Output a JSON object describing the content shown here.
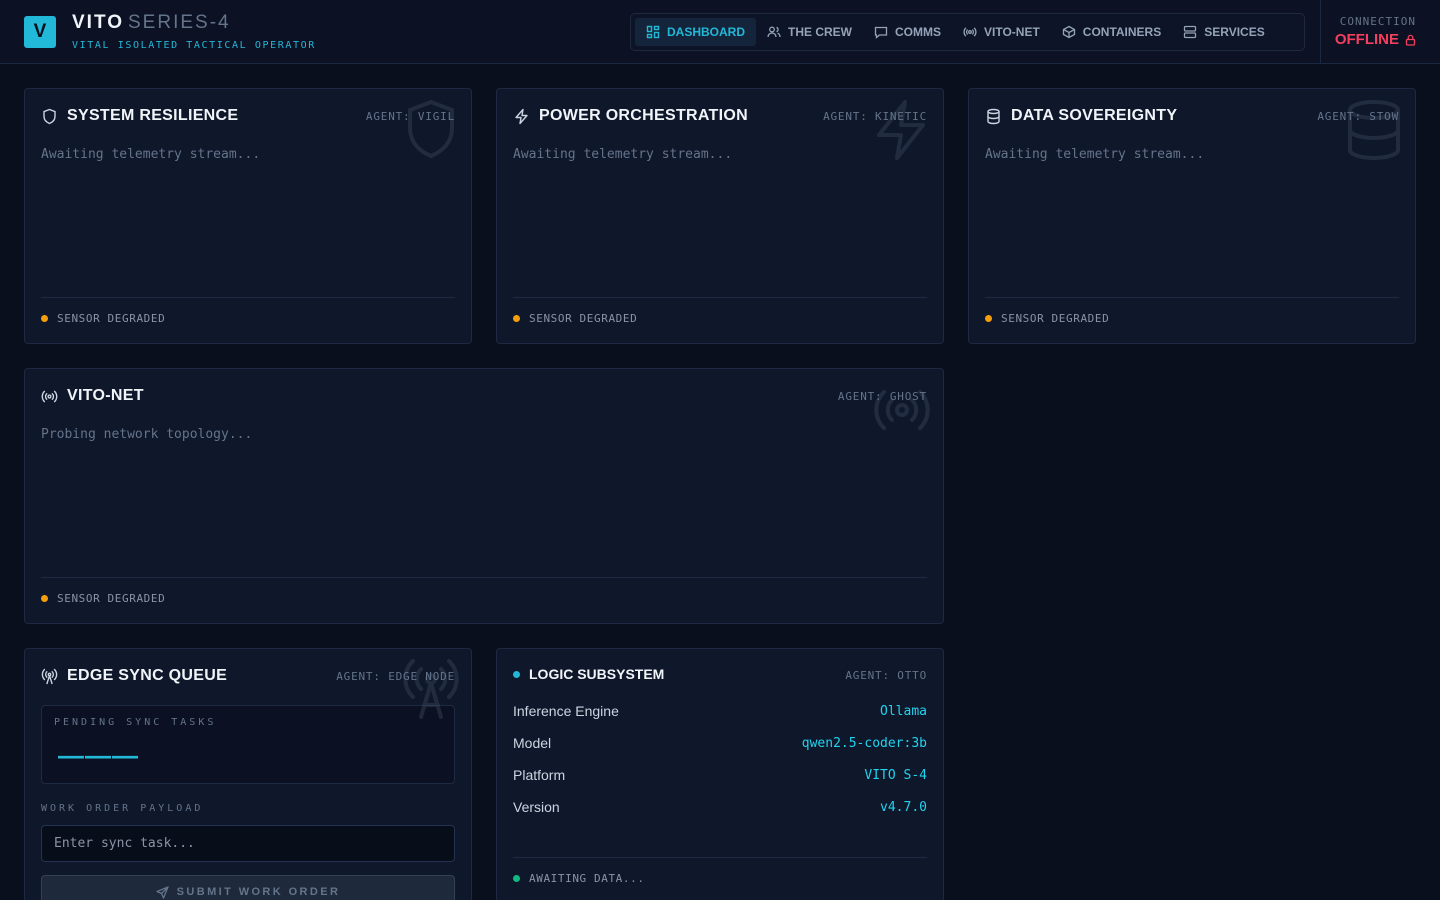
{
  "header": {
    "logo_letter": "V",
    "brand_name": "VITO",
    "brand_series": "SERIES-4",
    "brand_subtitle": "VITAL ISOLATED TACTICAL OPERATOR",
    "nav": [
      {
        "label": "DASHBOARD",
        "icon": "dashboard-icon",
        "active": true
      },
      {
        "label": "THE CREW",
        "icon": "users-icon",
        "active": false
      },
      {
        "label": "COMMS",
        "icon": "message-icon",
        "active": false
      },
      {
        "label": "VITO-NET",
        "icon": "radio-icon",
        "active": false
      },
      {
        "label": "CONTAINERS",
        "icon": "box-icon",
        "active": false
      },
      {
        "label": "SERVICES",
        "icon": "server-icon",
        "active": false
      }
    ],
    "connection_label": "CONNECTION",
    "connection_status": "OFFLINE"
  },
  "cards": {
    "resilience": {
      "title": "SYSTEM RESILIENCE",
      "agent": "AGENT: VIGIL",
      "message": "Awaiting telemetry stream...",
      "status": "SENSOR DEGRADED"
    },
    "power": {
      "title": "POWER ORCHESTRATION",
      "agent": "AGENT: KINETIC",
      "message": "Awaiting telemetry stream...",
      "status": "SENSOR DEGRADED"
    },
    "data": {
      "title": "DATA SOVEREIGNTY",
      "agent": "AGENT: STOW",
      "message": "Awaiting telemetry stream...",
      "status": "SENSOR DEGRADED"
    },
    "vitonet": {
      "title": "VITO-NET",
      "agent": "AGENT: GHOST",
      "message": "Probing network topology...",
      "status": "SENSOR DEGRADED"
    }
  },
  "edge_sync": {
    "title": "EDGE SYNC QUEUE",
    "agent": "AGENT: EDGE NODE",
    "pending_label": "PENDING SYNC TASKS",
    "pending_value": "———",
    "payload_label": "WORK ORDER PAYLOAD",
    "payload_placeholder": "Enter sync task...",
    "submit_label": "SUBMIT WORK ORDER"
  },
  "logic": {
    "title": "LOGIC SUBSYSTEM",
    "agent": "AGENT: OTTO",
    "rows": [
      {
        "key": "Inference Engine",
        "value": "Ollama"
      },
      {
        "key": "Model",
        "value": "qwen2.5-coder:3b"
      },
      {
        "key": "Platform",
        "value": "VITO S-4"
      },
      {
        "key": "Version",
        "value": "v4.7.0"
      }
    ],
    "status": "AWAITING DATA..."
  },
  "colors": {
    "accent": "#22b8d8",
    "offline": "#f43f5e",
    "warning": "#f59e0b",
    "ok": "#10b981"
  }
}
